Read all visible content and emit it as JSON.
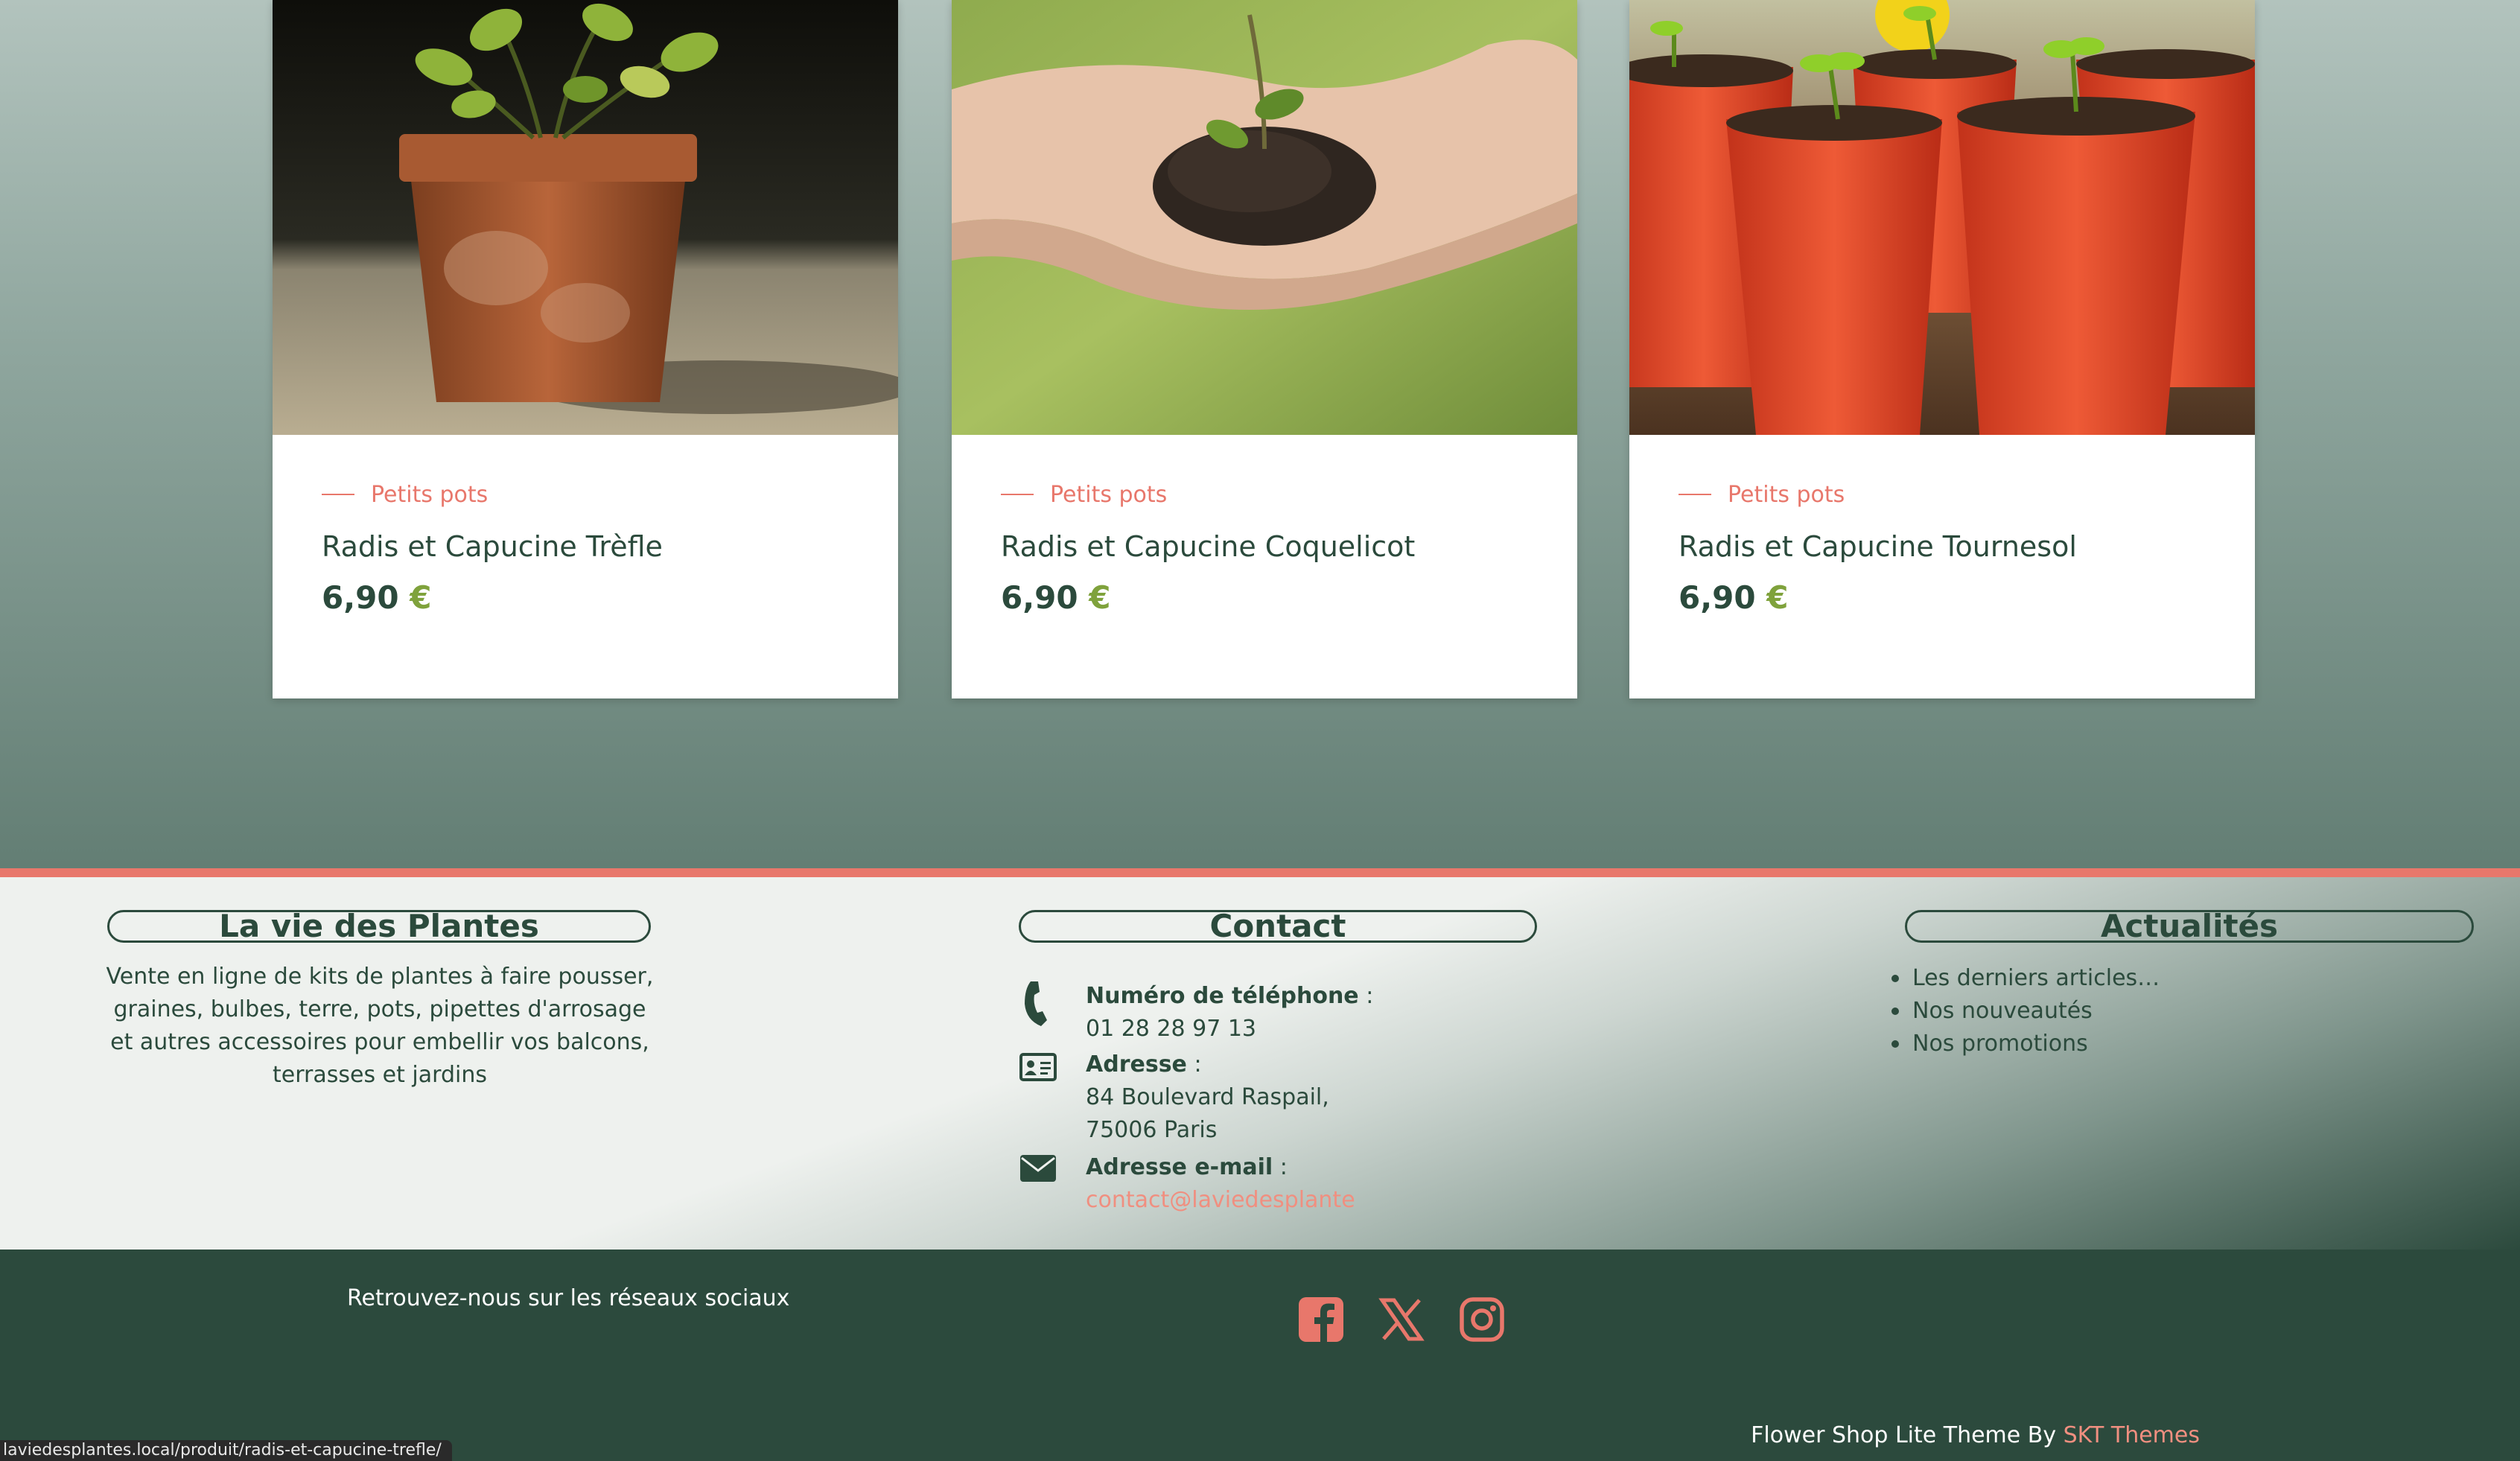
{
  "products": [
    {
      "category": "Petits pots",
      "name": "Radis et Capucine Trèfle",
      "price_amount": "6,90",
      "currency": "€",
      "image": "potted-plant-photo"
    },
    {
      "category": "Petits pots",
      "name": "Radis et Capucine Coquelicot",
      "price_amount": "6,90",
      "currency": "€",
      "image": "hand-holding-soil-seedling-photo"
    },
    {
      "category": "Petits pots",
      "name": "Radis et Capucine Tournesol",
      "price_amount": "6,90",
      "currency": "€",
      "image": "seedlings-in-red-pots-photo"
    }
  ],
  "footer": {
    "about": {
      "title": "La vie des Plantes",
      "text": "Vente en ligne de kits de plantes à faire pousser, graines, bulbes, terre, pots, pipettes d'arrosage et autres accessoires pour embellir vos balcons, terrasses et jardins"
    },
    "contact": {
      "title": "Contact",
      "phone_label": "Numéro de téléphone",
      "phone_value": "01 28 28 97 13",
      "address_label": "Adresse",
      "address_line1": "84 Boulevard Raspail,",
      "address_line2": "75006 Paris",
      "email_label": "Adresse e-mail",
      "email_value": "contact@laviedesplante",
      "separator": " :",
      "icons": [
        "phone-icon",
        "address-card-icon",
        "envelope-icon"
      ]
    },
    "news": {
      "title": "Actualités",
      "items": [
        "Les derniers articles…",
        "Nos nouveautés",
        "Nos promotions"
      ]
    }
  },
  "bottom_bar": {
    "social_label": "Retrouvez-nous sur les réseaux sociaux",
    "social_icons": [
      "facebook-icon",
      "x-icon",
      "instagram-icon"
    ],
    "credit_text": "Flower Shop Lite Theme By ",
    "credit_brand": "SKT Themes"
  },
  "status_bar_url": "laviedesplantes.local/produit/radis-et-capucine-trefle/",
  "colors": {
    "accent": "#e8776b",
    "dark_green": "#2c4a3d",
    "price_currency": "#7fa23c",
    "link": "#f08f80"
  }
}
